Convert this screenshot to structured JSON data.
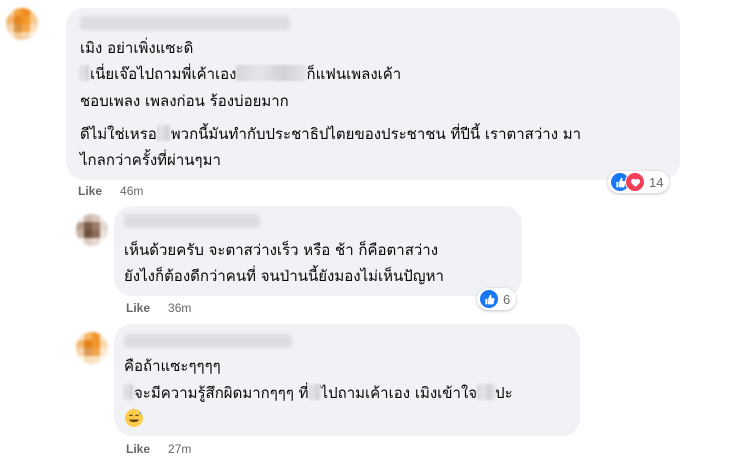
{
  "comments": [
    {
      "lines": [
        {
          "parts": [
            {
              "t": "เมิง อย่าเพิ่งแซะดิ"
            }
          ]
        },
        {
          "parts": [
            {
              "blur": 10
            },
            {
              "t": "เนี่ยเจ๊อไปถามพี่เค้าเอง"
            },
            {
              "blur": 70
            },
            {
              "t": "ก็แฟนเพลงเค้า"
            }
          ]
        },
        {
          "parts": [
            {
              "t": "ชอบเพลง เพลงก่อน ร้องบ่อยมาก"
            }
          ]
        },
        {
          "parts": [
            {
              "t": "ดีไม่ใช่เหรอ"
            },
            {
              "blur": 14
            },
            {
              "t": "พวกนี้มันทำกับประชาธิปไตยของประชาชน ที่ปีนี้ เราตาสว่าง มา"
            }
          ]
        },
        {
          "parts": [
            {
              "t": "ไกลกว่าครั้งที่ผ่านๆมา"
            }
          ]
        }
      ],
      "like_label": "Like",
      "time": "46m",
      "reactions": {
        "count": "14",
        "types": [
          "like-icon",
          "love-icon"
        ]
      }
    },
    {
      "lines": [
        {
          "parts": [
            {
              "t": "เห็นด้วยครับ จะตาสว่างเร็ว หรือ ช้า ก็คือตาสว่าง"
            }
          ]
        },
        {
          "parts": [
            {
              "t": "ยังไงก็ต้องดีกว่าคนที่ จนป่านนี้ยังมองไม่เห็นปัญหา"
            }
          ]
        }
      ],
      "like_label": "Like",
      "time": "36m",
      "reactions": {
        "count": "6",
        "types": [
          "like-icon"
        ]
      }
    },
    {
      "lines": [
        {
          "parts": [
            {
              "t": "คือถ้าแซะๆๆๆๆ"
            }
          ]
        },
        {
          "parts": [
            {
              "blur": 10
            },
            {
              "t": "จะมีความรู้สึกผิดมากๆๆๆ ที่"
            },
            {
              "blur": 12
            },
            {
              "t": "ไปถามเค้าเอง เมิงเข้าใจ"
            },
            {
              "blur": 18
            },
            {
              "t": "ปะ"
            }
          ]
        },
        {
          "parts": [
            {
              "emoji": "grinning-sweat-emoji"
            }
          ]
        }
      ],
      "like_label": "Like",
      "time": "27m",
      "reactions": null
    }
  ],
  "colors": {
    "bubble": "#f0f2f5",
    "meta_text": "#65676b",
    "like_blue": "#1877f2",
    "love_red": "#f33e58"
  }
}
